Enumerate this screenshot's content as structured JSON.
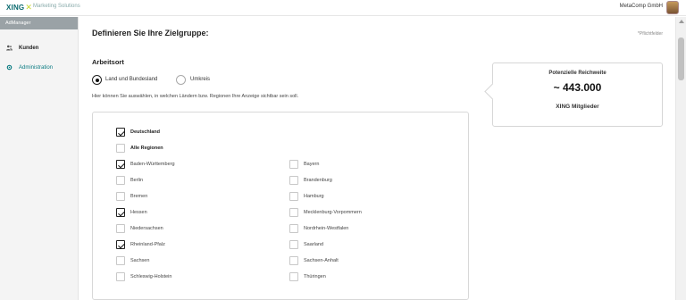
{
  "topbar": {
    "logo": "XING",
    "logo_mark": "✕",
    "subbrand": "Marketing Solutions",
    "company": "MetaComp GmbH"
  },
  "sidebar": {
    "header": "AdManager",
    "items": [
      {
        "label": "Kunden",
        "icon": "users-icon"
      },
      {
        "label": "Administration",
        "icon": "gear-icon"
      }
    ]
  },
  "main": {
    "title": "Definieren Sie Ihre Zielgruppe:",
    "required_note": "*Pflichtfelder",
    "section_title": "Arbeitsort",
    "radios": [
      {
        "label": "Land und Bundesland",
        "checked": true
      },
      {
        "label": "Umkreis",
        "checked": false
      }
    ],
    "hint": "Hier können Sie auswählen, in welchen Ländern bzw. Regionen Ihre Anzeige sichtbar sein soll.",
    "country": {
      "label": "Deutschland",
      "checked": true
    },
    "all_regions": {
      "label": "Alle Regionen",
      "checked": false
    },
    "regions_left": [
      {
        "label": "Baden-Württemberg",
        "checked": true
      },
      {
        "label": "Berlin",
        "checked": false
      },
      {
        "label": "Bremen",
        "checked": false
      },
      {
        "label": "Hessen",
        "checked": true
      },
      {
        "label": "Niedersachsen",
        "checked": false
      },
      {
        "label": "Rheinland-Pfalz",
        "checked": true
      },
      {
        "label": "Sachsen",
        "checked": false
      },
      {
        "label": "Schleswig-Holstein",
        "checked": false
      }
    ],
    "regions_right": [
      {
        "label": "Bayern",
        "checked": false
      },
      {
        "label": "Brandenburg",
        "checked": false
      },
      {
        "label": "Hamburg",
        "checked": false
      },
      {
        "label": "Mecklenburg-Vorpommern",
        "checked": false
      },
      {
        "label": "Nordrhein-Westfalen",
        "checked": false
      },
      {
        "label": "Saarland",
        "checked": false
      },
      {
        "label": "Sachsen-Anhalt",
        "checked": false
      },
      {
        "label": "Thüringen",
        "checked": false
      }
    ]
  },
  "reach": {
    "title": "Potenzielle Reichweite",
    "value": "~ 443.000",
    "subtitle": "XING Mitglieder"
  },
  "colors": {
    "brand": "#0b6a6f",
    "brand_accent": "#c6d82f",
    "sidebar_header": "#9aa2a6",
    "link": "#0a7b82"
  }
}
